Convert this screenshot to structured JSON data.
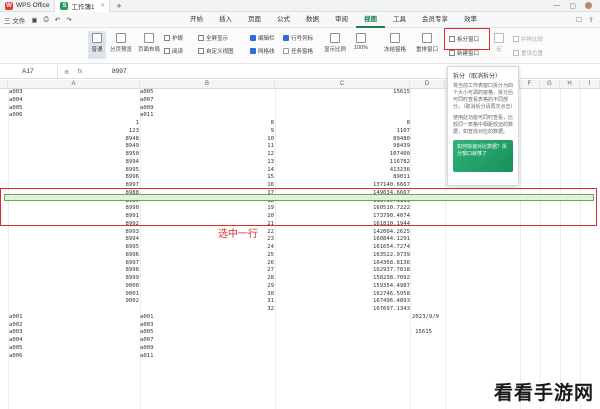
{
  "titlebar": {
    "app_tab": "WPS Office",
    "doc_tab": "工作簿1",
    "close_glyph": "×",
    "plus_glyph": "+"
  },
  "menubar": {
    "file": "三 文件",
    "tabs": [
      "开始",
      "插入",
      "页面",
      "公式",
      "数据",
      "审阅",
      "视图",
      "工具",
      "会员专享",
      "效率"
    ],
    "active_tab": "视图"
  },
  "ribbon": {
    "normal": "普通",
    "page_break_preview": "分页预览",
    "page_layout": "页面布局",
    "protect": "护眼",
    "read_mode": "阅读",
    "fullscreen": "全屏显示",
    "custom_view": "自定义视图",
    "edit_bar": "编辑栏",
    "gridlines": "网格线",
    "print_rows": "打印网格",
    "show_headers": "行号列标",
    "task_pane": "任务窗格",
    "zoom": "显示比例",
    "zoom_100": "100%",
    "freeze": "冻结窗格",
    "rearrange": "重排窗口",
    "split_window": "拆分窗口",
    "new_window": "新建窗口",
    "macro_a": "宏",
    "sync_scroll": "并排比较",
    "reset_pos": "重设位置"
  },
  "formula_bar": {
    "cell_ref": "A17",
    "value": "8997"
  },
  "columns": [
    "A",
    "B",
    "C",
    "D",
    "E",
    "F",
    "G",
    "H",
    "I"
  ],
  "rows": [
    {
      "n": "",
      "a": "a003",
      "b": "a005",
      "c": "15615",
      "d": ""
    },
    {
      "n": "",
      "a": "a004",
      "b": "a007",
      "c": "",
      "d": ""
    },
    {
      "n": "",
      "a": "a005",
      "b": "a009",
      "c": "",
      "d": ""
    },
    {
      "n": "",
      "a": "a006",
      "b": "a011",
      "c": "",
      "d": ""
    },
    {
      "n": "",
      "a": "1",
      "b": "8",
      "c": "8",
      "d": ""
    },
    {
      "n": "",
      "a": "123",
      "b": "9",
      "c": "1107",
      "d": ""
    },
    {
      "n": "",
      "a": "8948",
      "b": "10",
      "c": "89480",
      "d": ""
    },
    {
      "n": "",
      "a": "8949",
      "b": "11",
      "c": "98439",
      "d": ""
    },
    {
      "n": "",
      "a": "8950",
      "b": "12",
      "c": "107400",
      "d": ""
    },
    {
      "n": "",
      "a": "8994",
      "b": "13",
      "c": "116782",
      "d": ""
    },
    {
      "n": "",
      "a": "8995",
      "b": "14",
      "c": "413236",
      "d": ""
    },
    {
      "n": "",
      "a": "8996",
      "b": "15",
      "c": "89011",
      "d": ""
    },
    {
      "n": "",
      "a": "8997",
      "b": "16",
      "c": "137140.6667",
      "d": ""
    },
    {
      "n": "",
      "a": "8988",
      "b": "17",
      "c": "149034.6667",
      "d": ""
    },
    {
      "n": "",
      "a": "8989",
      "b": "18",
      "c": "113719.1111",
      "d": ""
    },
    {
      "n": "",
      "a": "8990",
      "b": "19",
      "c": "160510.7222",
      "d": ""
    },
    {
      "n": "",
      "a": "8991",
      "b": "20",
      "c": "173790.4074",
      "d": ""
    },
    {
      "n": "",
      "a": "8992",
      "b": "21",
      "c": "161810.1944",
      "d": ""
    },
    {
      "n": "",
      "a": "8993",
      "b": "22",
      "c": "142004.2625",
      "d": ""
    },
    {
      "n": "",
      "a": "8994",
      "b": "23",
      "c": "160844.1291",
      "d": ""
    },
    {
      "n": "",
      "a": "8995",
      "b": "24",
      "c": "161654.7274",
      "d": ""
    },
    {
      "n": "",
      "a": "8996",
      "b": "25",
      "c": "163522.9739",
      "d": ""
    },
    {
      "n": "",
      "a": "8997",
      "b": "26",
      "c": "164368.8136",
      "d": ""
    },
    {
      "n": "",
      "a": "8998",
      "b": "27",
      "c": "162937.7818",
      "d": ""
    },
    {
      "n": "",
      "a": "8999",
      "b": "28",
      "c": "158238.7092",
      "d": ""
    },
    {
      "n": "",
      "a": "9000",
      "b": "29",
      "c": "159354.4987",
      "d": ""
    },
    {
      "n": "",
      "a": "9001",
      "b": "30",
      "c": "162746.5958",
      "d": ""
    },
    {
      "n": "",
      "a": "9002",
      "b": "31",
      "c": "167496.4893",
      "d": ""
    },
    {
      "n": "",
      "a": "",
      "b": "32",
      "c": "167697.1343",
      "d": ""
    },
    {
      "n": "",
      "a": "a001",
      "b": "a001",
      "c": "",
      "d": "2023/9/9"
    },
    {
      "n": "",
      "a": "a002",
      "b": "a003",
      "c": "",
      "d": ""
    },
    {
      "n": "",
      "a": "a003",
      "b": "a005",
      "c": "",
      "d": "15615"
    },
    {
      "n": "",
      "a": "a004",
      "b": "a007",
      "c": "",
      "d": ""
    },
    {
      "n": "",
      "a": "a005",
      "b": "a009",
      "c": "",
      "d": ""
    },
    {
      "n": "",
      "a": "a006",
      "b": "a011",
      "c": "",
      "d": ""
    }
  ],
  "annotation": "选中一行",
  "tooltip": {
    "title": "拆分（取消拆分）",
    "body": "将当前工作表窗口拆分为四个大小可调的窗格，拆分后可同时查看表格的不同部分。（取消拆分请再次点击）",
    "body2": "使用此功能可同时查看，比较同一表格中相距较远的数据，如查找对应的数据。",
    "card": "如何快速对比数据？拆分窗口就够了"
  },
  "watermark": "看看手游网",
  "colors": {
    "accent": "#1a7f4b",
    "highlight_red": "#e02b2b",
    "selection": "#e3f0dc"
  }
}
